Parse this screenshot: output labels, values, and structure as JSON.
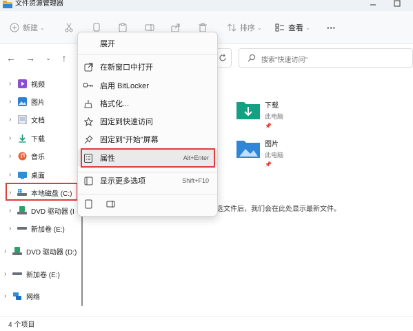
{
  "window": {
    "title": "文件资源管理器"
  },
  "toolbar": {
    "new_label": "新建",
    "sort_label": "排序",
    "view_label": "查看",
    "more_label": "···"
  },
  "search": {
    "placeholder": "搜索\"快速访问\""
  },
  "sidebar": {
    "items": [
      {
        "label": "视频",
        "icon": "video-folder-icon"
      },
      {
        "label": "图片",
        "icon": "pictures-folder-icon"
      },
      {
        "label": "文档",
        "icon": "documents-folder-icon"
      },
      {
        "label": "下载",
        "icon": "download-icon"
      },
      {
        "label": "音乐",
        "icon": "music-folder-icon"
      },
      {
        "label": "桌面",
        "icon": "desktop-folder-icon"
      },
      {
        "label": "本地磁盘 (C:)",
        "icon": "local-disk-icon"
      },
      {
        "label": "DVD 驱动器 (I",
        "icon": "dvd-drive-icon"
      },
      {
        "label": "新加卷 (E:)",
        "icon": "drive-icon"
      },
      {
        "label": "DVD 驱动器 (D:)",
        "icon": "dvd-drive-icon"
      },
      {
        "label": "新加卷 (E:)",
        "icon": "drive-icon"
      },
      {
        "label": "网络",
        "icon": "network-icon"
      }
    ]
  },
  "content": {
    "folders": [
      {
        "name": "下载",
        "sub": "此电脑"
      },
      {
        "name": "图片",
        "sub": "此电脑"
      }
    ],
    "hint": "选文件后，我们会在此处显示最新文件。"
  },
  "context_menu": {
    "items": [
      {
        "label": "展开",
        "shortcut": ""
      },
      {
        "label": "在新窗口中打开",
        "shortcut": ""
      },
      {
        "label": "启用 BitLocker",
        "shortcut": ""
      },
      {
        "label": "格式化...",
        "shortcut": ""
      },
      {
        "label": "固定到快速访问",
        "shortcut": ""
      },
      {
        "label": "固定到\"开始\"屏幕",
        "shortcut": ""
      },
      {
        "label": "属性",
        "shortcut": "Alt+Enter"
      },
      {
        "label": "显示更多选项",
        "shortcut": "Shift+F10"
      }
    ]
  },
  "status": {
    "count": "4 个项目"
  },
  "colors": {
    "accent": "#0078d4",
    "highlight_border": "#e03c3c",
    "folder_teal": "#1aa38a"
  }
}
